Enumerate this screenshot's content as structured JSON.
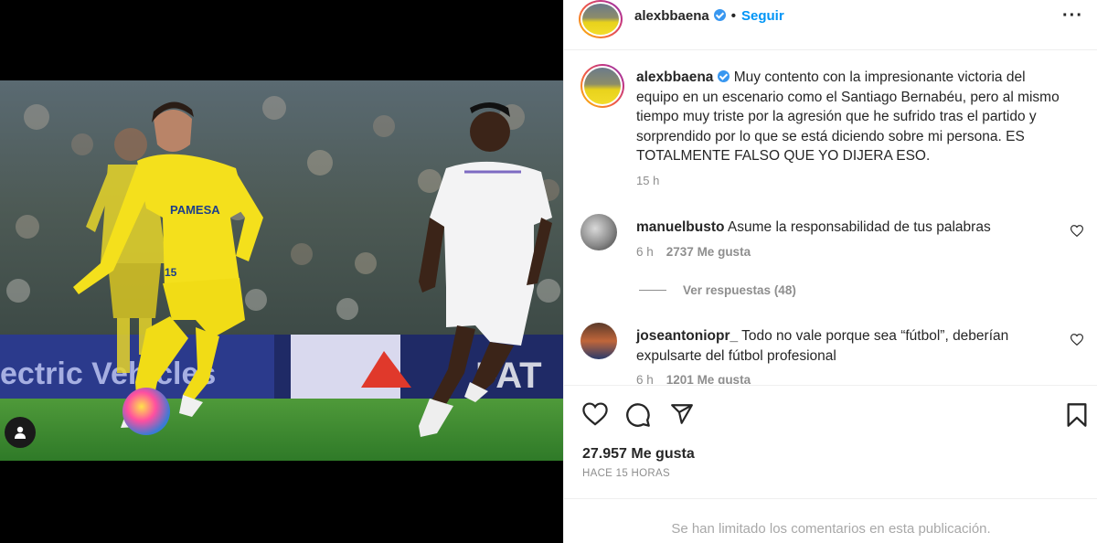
{
  "post": {
    "username": "alexbbaena",
    "follow_label": "Seguir",
    "separator": "•"
  },
  "caption": {
    "username": "alexbbaena",
    "text": "Muy contento con la impresionante victoria del equipo en un escenario como el Santiago Bernabéu, pero al mismo tiempo muy triste por la agresión que he sufrido tras el partido y sorprendido por lo que se está diciendo sobre mi persona. ES TOTALMENTE FALSO QUE YO DIJERA ESO.",
    "time": "15 h"
  },
  "comments": [
    {
      "username": "manuelbusto",
      "text": "Asume la responsabilidad de tus palabras",
      "time": "6 h",
      "likes": "2737 Me gusta",
      "replies_label": "Ver respuestas (48)"
    },
    {
      "username": "joseantoniopr_",
      "text": "Todo no vale porque sea “fútbol”, deberían expulsarte del fútbol profesional",
      "time": "6 h",
      "likes": "1201 Me gusta"
    }
  ],
  "actions": {
    "likes_count": "27.957 Me gusta",
    "time_ago": "HACE 15 HORAS"
  },
  "footer": {
    "limited_comments": "Se han limitado los comentarios en esta publicación."
  },
  "photo": {
    "board_text_left": "ectric Vehicles",
    "board_text_right": "FAT",
    "shirt_sponsor": "PAMESA",
    "shirt_number": "15"
  },
  "colors": {
    "follow": "#0095f6",
    "verified": "#3897f0",
    "muted": "#8e8e8e",
    "villarreal_yellow": "#f4e01c"
  },
  "icons": [
    "tag-user-icon",
    "verified-icon",
    "more-options-icon",
    "heart-icon",
    "comment-icon",
    "share-icon",
    "bookmark-icon"
  ]
}
